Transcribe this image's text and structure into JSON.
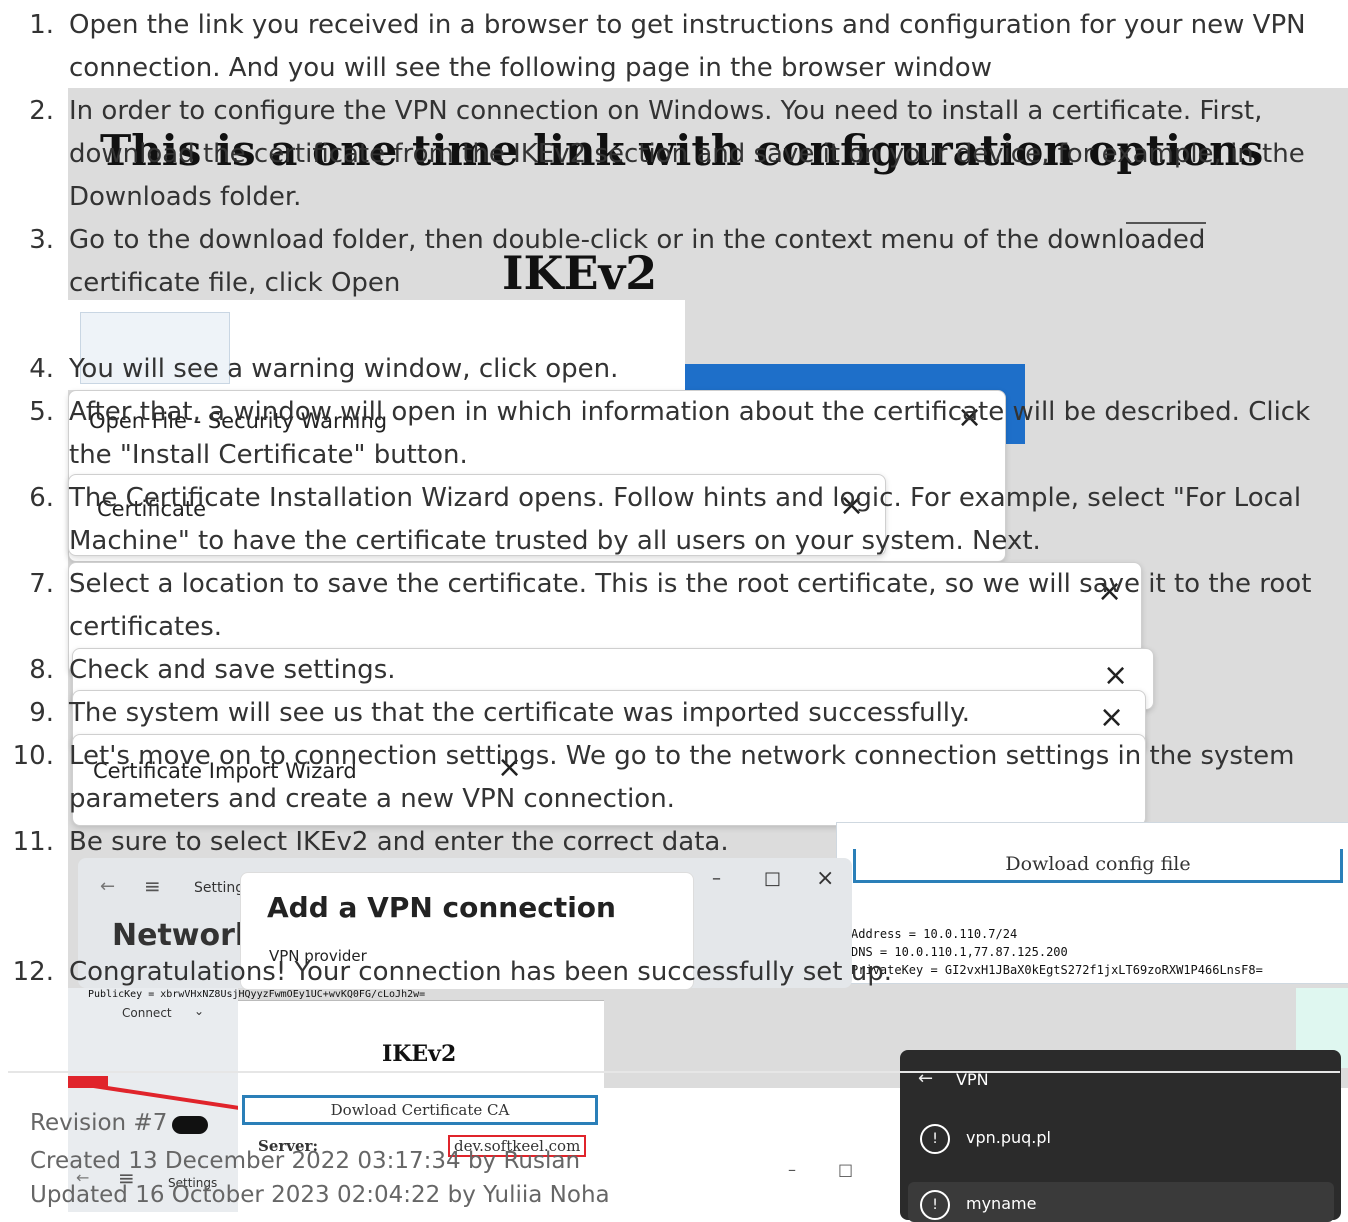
{
  "steps": [
    {
      "num": "1.",
      "text": "Open the link you received in a browser to get instructions and configuration for your new VPN connection. And you will see the following page in the browser window"
    },
    {
      "num": "2.",
      "text": "In order to configure the VPN connection on Windows. You need to install a certificate. First, download the certificate from the IKEv2 section and save it on your device, for example, in the Downloads folder."
    },
    {
      "num": "3.",
      "text": "Go to the download folder, then double-click or in the context menu of the downloaded certificate file, click Open"
    },
    {
      "num": "4.",
      "text": "You will see a warning window, click open."
    },
    {
      "num": "5.",
      "text": "After that, a window will open in which information about the certificate will be described. Click the \"Install Certificate\" button."
    },
    {
      "num": "6.",
      "text": "The Certificate Installation Wizard opens. Follow hints and logic. For example, select \"For Local Machine\" to have the certificate trusted by all users on your system. Next."
    },
    {
      "num": "7.",
      "text": "Select a location to save the certificate. This is the root certificate, so we will save it to the root certificates."
    },
    {
      "num": "8.",
      "text": "Check and save settings."
    },
    {
      "num": "9.",
      "text": "The system will see us that the certificate was imported successfully."
    },
    {
      "num": "10.",
      "text": "Let's move on to connection settings. We go to the network connection settings in the system parameters and create a new VPN connection."
    },
    {
      "num": "11.",
      "text": "Be sure to select IKEv2 and enter the correct data."
    },
    {
      "num": "12.",
      "text": "Congratulations! Your connection has been successfully set up."
    }
  ],
  "meta": {
    "revision": "Revision #7",
    "created": "Created 13 December 2022 03:17:34 by Ruslan",
    "updated": "Updated 16 October 2023 02:04:22 by Yuliia Noha"
  },
  "screens": {
    "onetime_heading": "This is a one time link with configuration options",
    "ikev2_heading": "IKEv2",
    "open_file_warning": "Open File - Security Warning",
    "certificate_title": "Certificate",
    "import_wizard_title": "Certificate Import Wizard",
    "download_config": "Dowload config file",
    "config_address": "Address = 10.0.110.7/24",
    "config_dns": "DNS = 10.0.110.1,77.87.125.200",
    "config_privatekey": "PrivateKey = GI2vxH1JBaX0kEgtS272f1jxLT69zoRXW1P466LnsF8=",
    "config_publickey": "PublicKey = xbrwVHxNZ8UsjHQyyzFwmOEy1UC+wvKQ0FG/cLoJh2w=",
    "settings_label": "Settings",
    "network_heading": "Network",
    "add_vpn_title": "Add a VPN connection",
    "vpn_provider_label": "VPN provider",
    "connect_label": "Connect",
    "ikev2_box_heading": "IKEv2",
    "download_ca_button": "Dowload Certificate CA",
    "server_label": "Server:",
    "server_value": "dev.softkeel.com",
    "vpn_panel_title": "VPN",
    "vpn_item_1": "vpn.puq.pl",
    "vpn_item_2": "myname"
  }
}
